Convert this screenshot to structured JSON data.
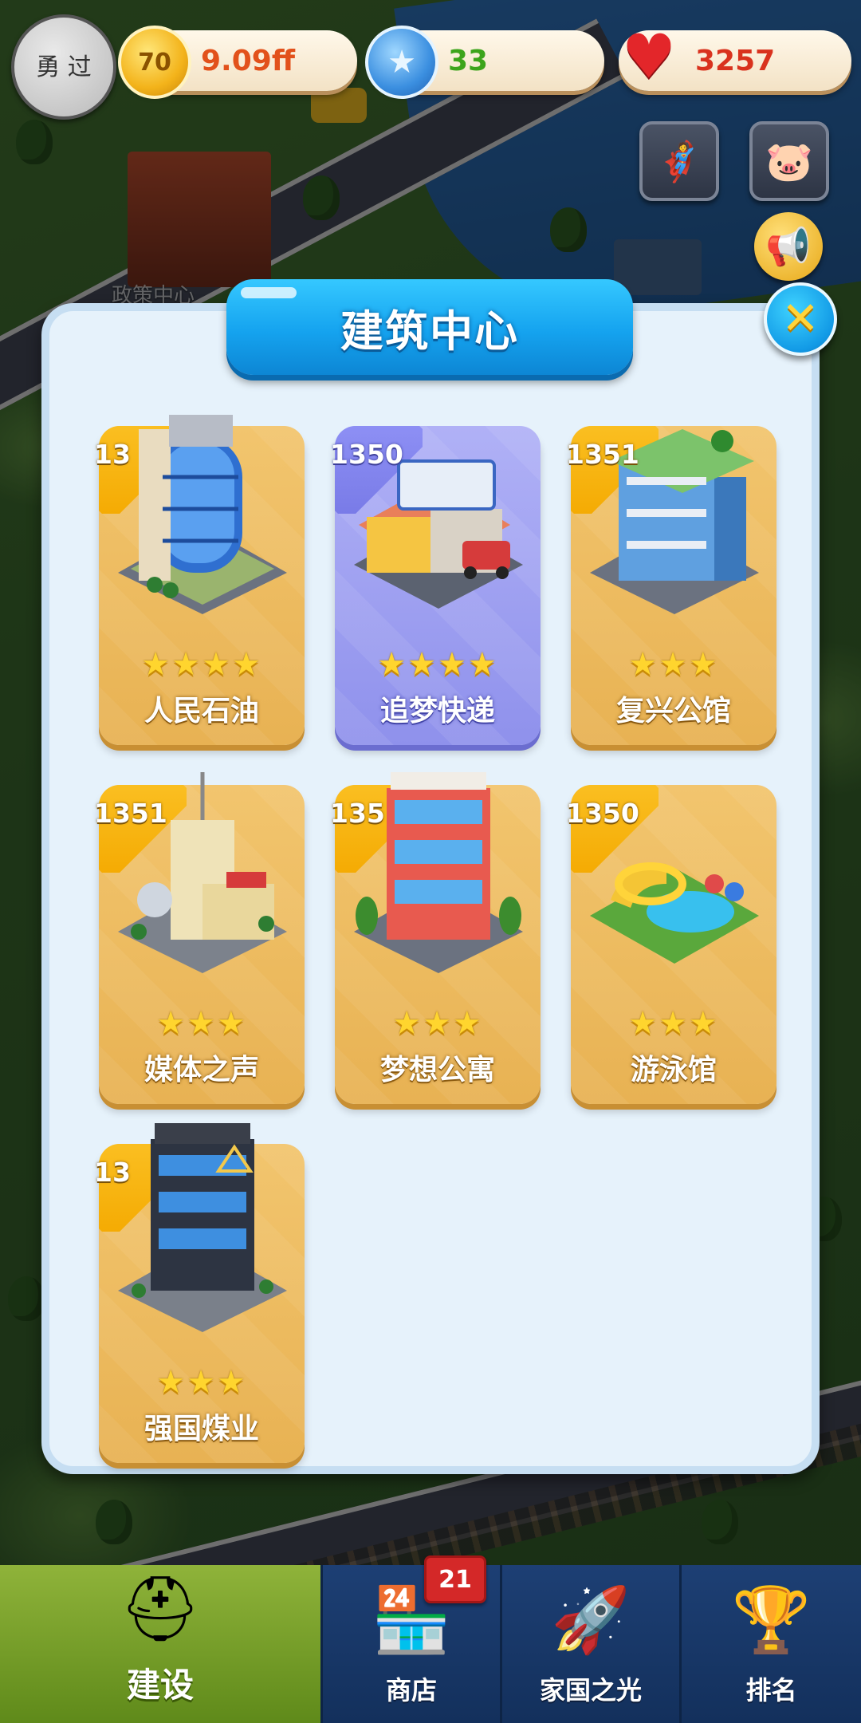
{
  "hud": {
    "avatar_text": "勇 过",
    "coins": {
      "value": "9.09ff",
      "icon": "coin-icon"
    },
    "stars": {
      "value": "33",
      "icon": "blue-star-icon"
    },
    "hearts": {
      "value": "3257",
      "icon": "heart-icon"
    }
  },
  "map": {
    "label": "政策中心"
  },
  "dialog": {
    "title": "建筑中心",
    "close_icon": "close-icon",
    "cards": [
      {
        "num": "13",
        "name": "人民石油",
        "stars": "★★★★",
        "selected": false
      },
      {
        "num": "1350",
        "name": "追梦快递",
        "stars": "★★★★",
        "selected": true
      },
      {
        "num": "1351",
        "name": "复兴公馆",
        "stars": "★★★",
        "selected": false
      },
      {
        "num": "1351",
        "name": "媒体之声",
        "stars": "★★★",
        "selected": false
      },
      {
        "num": "135",
        "name": "梦想公寓",
        "stars": "★★★",
        "selected": false
      },
      {
        "num": "1350",
        "name": "游泳馆",
        "stars": "★★★",
        "selected": false
      },
      {
        "num": "13",
        "name": "强国煤业",
        "stars": "★★★",
        "selected": false
      }
    ]
  },
  "nav": {
    "items": [
      {
        "label": "建设",
        "icon": "hardhat-icon",
        "active": true
      },
      {
        "label": "商店",
        "icon": "shop-icon",
        "active": false,
        "badge": "21"
      },
      {
        "label": "家国之光",
        "icon": "rocket-icon",
        "active": false
      },
      {
        "label": "排名",
        "icon": "ranking-icon",
        "active": false
      }
    ]
  },
  "colors": {
    "accent": "#15a3ef",
    "card": "#e8b253",
    "card_selected": "#8f91ec",
    "nav": "#1d3f74"
  }
}
